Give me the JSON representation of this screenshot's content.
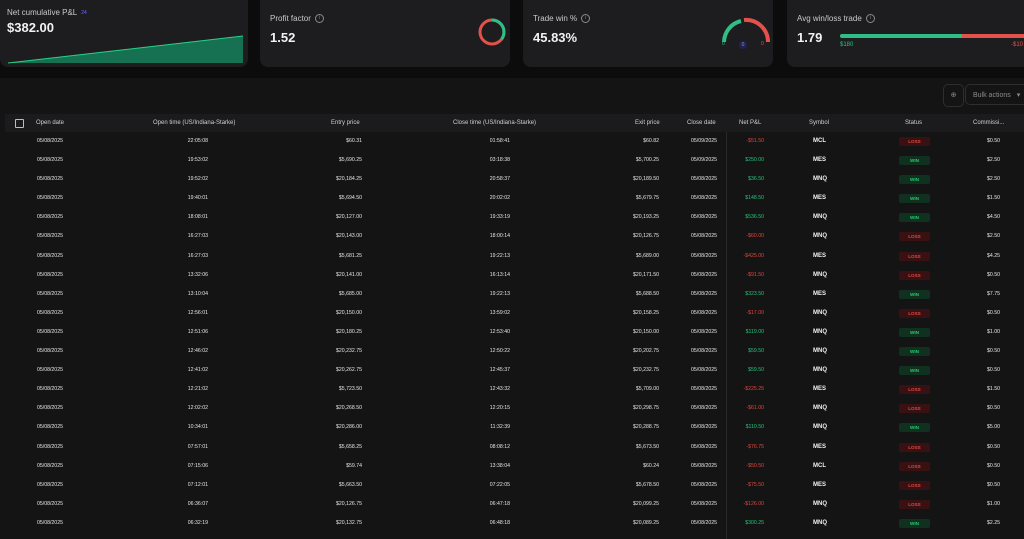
{
  "cards": {
    "net_pnl": {
      "title": "Net cumulative P&L",
      "count": "24",
      "value": "$382.00"
    },
    "profit_factor": {
      "title": "Profit factor",
      "value": "1.52"
    },
    "trade_win": {
      "title": "Trade win %",
      "value": "45.83%",
      "wins": "0",
      "breakeven": "0",
      "losses": "0"
    },
    "avg_win_loss": {
      "title": "Avg win/loss trade",
      "value": "1.79",
      "avg_win": "$180",
      "avg_loss": "-$10"
    }
  },
  "toolbar": {
    "bulk_actions": "Bulk actions"
  },
  "table": {
    "headers": {
      "open_date": "Open date",
      "open_time": "Open time (US/Indiana-Starke)",
      "entry_price": "Entry price",
      "close_time": "Close time (US/Indiana-Starke)",
      "exit_price": "Exit price",
      "close_date": "Close date",
      "net_pnl": "Net P&L",
      "symbol": "Symbol",
      "status": "Status",
      "commission": "Commissi..."
    },
    "rows": [
      {
        "open_date": "05/08/2025",
        "open_time": "22:05:08",
        "entry": "$60.31",
        "close_time": "01:58:41",
        "exit": "$60.82",
        "close_date": "05/09/2025",
        "pnl": "-$51.50",
        "symbol": "MCL",
        "status": "LOSS",
        "comm": "$0.50"
      },
      {
        "open_date": "05/08/2025",
        "open_time": "19:53:02",
        "entry": "$5,690.25",
        "close_time": "03:18:38",
        "exit": "$5,700.25",
        "close_date": "05/09/2025",
        "pnl": "$250.00",
        "symbol": "MES",
        "status": "WIN",
        "comm": "$2.50"
      },
      {
        "open_date": "05/08/2025",
        "open_time": "19:52:02",
        "entry": "$20,184.25",
        "close_time": "20:58:37",
        "exit": "$20,189.50",
        "close_date": "05/08/2025",
        "pnl": "$36.50",
        "symbol": "MNQ",
        "status": "WIN",
        "comm": "$2.50"
      },
      {
        "open_date": "05/08/2025",
        "open_time": "19:40:01",
        "entry": "$5,694.50",
        "close_time": "20:02:02",
        "exit": "$5,679.75",
        "close_date": "05/08/2025",
        "pnl": "$148.50",
        "symbol": "MES",
        "status": "WIN",
        "comm": "$1.50"
      },
      {
        "open_date": "05/08/2025",
        "open_time": "18:08:01",
        "entry": "$20,127.00",
        "close_time": "19:33:19",
        "exit": "$20,193.25",
        "close_date": "05/08/2025",
        "pnl": "$536.50",
        "symbol": "MNQ",
        "status": "WIN",
        "comm": "$4.50"
      },
      {
        "open_date": "05/08/2025",
        "open_time": "16:27:03",
        "entry": "$20,143.00",
        "close_time": "18:00:14",
        "exit": "$20,126.75",
        "close_date": "05/08/2025",
        "pnl": "-$60.00",
        "symbol": "MNQ",
        "status": "LOSS",
        "comm": "$2.50"
      },
      {
        "open_date": "05/08/2025",
        "open_time": "16:27:03",
        "entry": "$5,681.25",
        "close_time": "19:22:13",
        "exit": "$5,689.00",
        "close_date": "05/08/2025",
        "pnl": "-$425.00",
        "symbol": "MES",
        "status": "LOSS",
        "comm": "$4.25"
      },
      {
        "open_date": "05/08/2025",
        "open_time": "13:32:06",
        "entry": "$20,141.00",
        "close_time": "16:13:14",
        "exit": "$20,171.50",
        "close_date": "05/08/2025",
        "pnl": "-$91.50",
        "symbol": "MNQ",
        "status": "LOSS",
        "comm": "$0.50"
      },
      {
        "open_date": "05/08/2025",
        "open_time": "13:10:04",
        "entry": "$5,685.00",
        "close_time": "19:22:13",
        "exit": "$5,688.50",
        "close_date": "05/08/2025",
        "pnl": "$323.50",
        "symbol": "MES",
        "status": "WIN",
        "comm": "$7.75"
      },
      {
        "open_date": "05/08/2025",
        "open_time": "12:56:01",
        "entry": "$20,150.00",
        "close_time": "13:59:02",
        "exit": "$20,158.25",
        "close_date": "05/08/2025",
        "pnl": "-$17.00",
        "symbol": "MNQ",
        "status": "LOSS",
        "comm": "$0.50"
      },
      {
        "open_date": "05/08/2025",
        "open_time": "12:51:06",
        "entry": "$20,180.25",
        "close_time": "12:53:40",
        "exit": "$20,150.00",
        "close_date": "05/08/2025",
        "pnl": "$119.00",
        "symbol": "MNQ",
        "status": "WIN",
        "comm": "$1.00"
      },
      {
        "open_date": "05/08/2025",
        "open_time": "12:46:02",
        "entry": "$20,232.75",
        "close_time": "12:50:22",
        "exit": "$20,202.75",
        "close_date": "05/08/2025",
        "pnl": "$59.50",
        "symbol": "MNQ",
        "status": "WIN",
        "comm": "$0.50"
      },
      {
        "open_date": "05/08/2025",
        "open_time": "12:41:02",
        "entry": "$20,262.75",
        "close_time": "12:45:37",
        "exit": "$20,232.75",
        "close_date": "05/08/2025",
        "pnl": "$59.50",
        "symbol": "MNQ",
        "status": "WIN",
        "comm": "$0.50"
      },
      {
        "open_date": "05/08/2025",
        "open_time": "12:21:02",
        "entry": "$5,723.50",
        "close_time": "12:43:32",
        "exit": "$5,709.00",
        "close_date": "05/08/2025",
        "pnl": "-$225.25",
        "symbol": "MES",
        "status": "LOSS",
        "comm": "$1.50"
      },
      {
        "open_date": "05/08/2025",
        "open_time": "12:02:02",
        "entry": "$20,268.50",
        "close_time": "12:20:15",
        "exit": "$20,298.75",
        "close_date": "05/08/2025",
        "pnl": "-$61.00",
        "symbol": "MNQ",
        "status": "LOSS",
        "comm": "$0.50"
      },
      {
        "open_date": "05/08/2025",
        "open_time": "10:34:01",
        "entry": "$20,286.00",
        "close_time": "11:32:39",
        "exit": "$20,288.75",
        "close_date": "05/08/2025",
        "pnl": "$110.50",
        "symbol": "MNQ",
        "status": "WIN",
        "comm": "$5.00"
      },
      {
        "open_date": "05/08/2025",
        "open_time": "07:57:01",
        "entry": "$5,658.25",
        "close_time": "08:08:12",
        "exit": "$5,673.50",
        "close_date": "05/08/2025",
        "pnl": "-$76.75",
        "symbol": "MES",
        "status": "LOSS",
        "comm": "$0.50"
      },
      {
        "open_date": "05/08/2025",
        "open_time": "07:15:06",
        "entry": "$59.74",
        "close_time": "13:38:04",
        "exit": "$60.24",
        "close_date": "05/08/2025",
        "pnl": "-$50.50",
        "symbol": "MCL",
        "status": "LOSS",
        "comm": "$0.50"
      },
      {
        "open_date": "05/08/2025",
        "open_time": "07:12:01",
        "entry": "$5,663.50",
        "close_time": "07:22:05",
        "exit": "$5,678.50",
        "close_date": "05/08/2025",
        "pnl": "-$75.50",
        "symbol": "MES",
        "status": "LOSS",
        "comm": "$0.50"
      },
      {
        "open_date": "05/08/2025",
        "open_time": "06:36:07",
        "entry": "$20,126.75",
        "close_time": "06:47:18",
        "exit": "$20,099.25",
        "close_date": "05/08/2025",
        "pnl": "-$126.00",
        "symbol": "MNQ",
        "status": "LOSS",
        "comm": "$1.00"
      },
      {
        "open_date": "05/08/2025",
        "open_time": "06:32:19",
        "entry": "$20,132.75",
        "close_time": "06:48:18",
        "exit": "$20,089.25",
        "close_date": "05/08/2025",
        "pnl": "$300.25",
        "symbol": "MNQ",
        "status": "WIN",
        "comm": "$2.25"
      }
    ]
  }
}
